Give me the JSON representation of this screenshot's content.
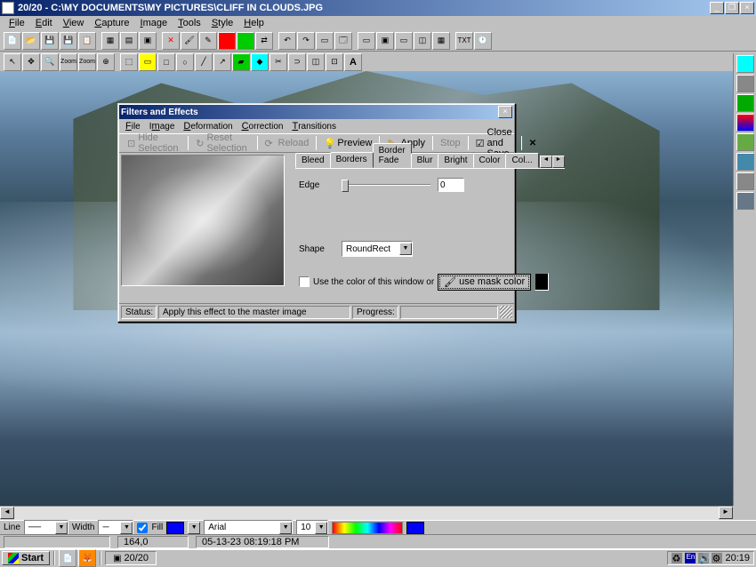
{
  "main": {
    "title": "20/20 - C:\\MY DOCUMENTS\\MY PICTURES\\CLIFF IN CLOUDS.JPG",
    "menu": [
      "File",
      "Edit",
      "View",
      "Capture",
      "Image",
      "Tools",
      "Style",
      "Help"
    ]
  },
  "dialog": {
    "title": "Filters and Effects",
    "menu": [
      "File",
      "Image",
      "Deformation",
      "Correction",
      "Transitions"
    ],
    "toolbar": {
      "hide_sel": "Hide Selection",
      "reset_sel": "Reset Selection",
      "reload": "Reload",
      "preview": "Preview",
      "apply": "Apply",
      "stop": "Stop",
      "close_save": "Close and Save"
    },
    "tabs": [
      "Bleed",
      "Borders",
      "Border Fade",
      "Blur",
      "Bright",
      "Color",
      "Col..."
    ],
    "active_tab": "Borders",
    "edge": {
      "label": "Edge",
      "value": "0"
    },
    "shape": {
      "label": "Shape",
      "value": "RoundRect"
    },
    "use_color": {
      "label": "Use  the color of this window or",
      "checked": false
    },
    "mask_btn": "use mask color",
    "status": {
      "label": "Status:",
      "text": "Apply this effect to the master image",
      "progress": "Progress:"
    }
  },
  "options_bar": {
    "line": "Line",
    "width": "Width",
    "fill": "Fill",
    "font": "Arial",
    "ten": "10"
  },
  "status": {
    "val1": "164,0",
    "val2": "05-13-23 08:19:18 PM"
  },
  "taskbar": {
    "start": "Start",
    "app": "20/20",
    "lang": "En",
    "time": "20:19"
  }
}
